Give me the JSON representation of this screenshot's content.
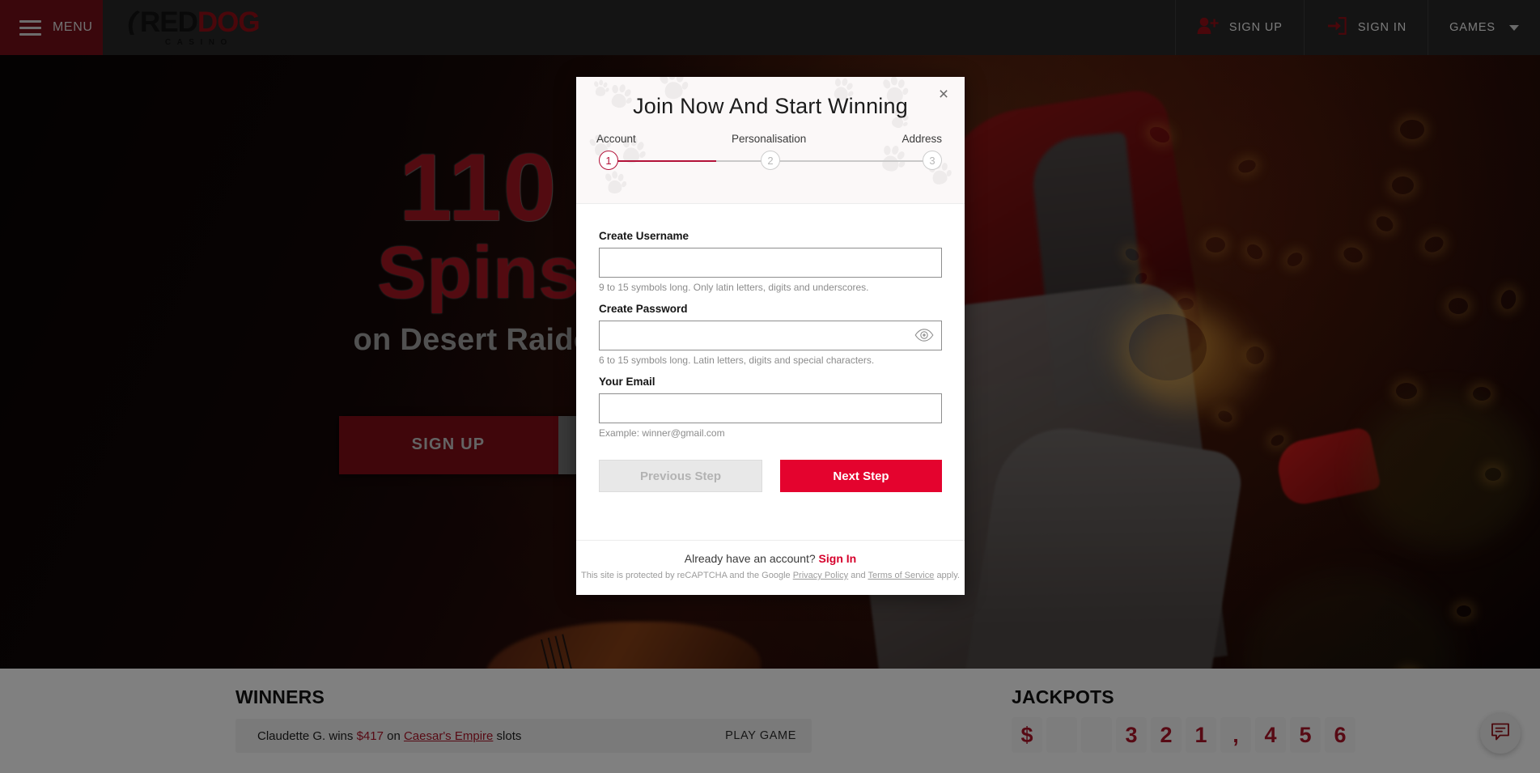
{
  "header": {
    "menu_label": "MENU",
    "logo": {
      "part1": "RED",
      "part2": "DOG",
      "sub": "CASINO"
    },
    "signup_label": "SIGN UP",
    "signin_label": "SIGN IN",
    "games_label": "GAMES"
  },
  "hero": {
    "count": "110",
    "spins": "Spins",
    "subtitle": "on Desert Raider",
    "cta_label": "SIGN UP"
  },
  "modal": {
    "title": "Join Now And Start Winning",
    "close_label": "×",
    "steps": [
      {
        "label": "Account",
        "number": "1",
        "active": true
      },
      {
        "label": "Personalisation",
        "number": "2",
        "active": false
      },
      {
        "label": "Address",
        "number": "3",
        "active": false
      }
    ],
    "fields": {
      "username": {
        "label": "Create Username",
        "value": "",
        "placeholder": "",
        "hint": "9 to 15 symbols long. Only latin letters, digits and underscores."
      },
      "password": {
        "label": "Create Password",
        "value": "",
        "placeholder": "",
        "hint": "6 to 15 symbols long. Latin letters, digits and special characters."
      },
      "email": {
        "label": "Your Email",
        "value": "",
        "placeholder": "",
        "hint": "Example: winner@gmail.com"
      }
    },
    "buttons": {
      "previous": "Previous Step",
      "next": "Next Step"
    },
    "footer": {
      "account_prompt": "Already have an account?",
      "signin_link": "Sign In",
      "recaptcha_pre": "This site is protected by reCAPTCHA and the Google",
      "privacy_link": "Privacy Policy",
      "recaptcha_mid": "and",
      "terms_link": "Terms of Service",
      "recaptcha_post": "apply."
    }
  },
  "winners": {
    "title": "WINNERS",
    "rows": [
      {
        "name": "Claudette G. wins",
        "amount": "$417",
        "on": "on",
        "game": "Caesar's Empire",
        "kind": "slots",
        "action": "PLAY GAME"
      }
    ]
  },
  "jackpots": {
    "title": "JACKPOTS",
    "tiles": [
      "$",
      "",
      "",
      "3",
      "2",
      "1",
      ",",
      "4",
      "5",
      "6"
    ]
  },
  "colors": {
    "brand_red": "#8d0f16",
    "accent_red": "#e4032e",
    "crimson": "#b31239",
    "menu_red": "#6e0f17"
  }
}
